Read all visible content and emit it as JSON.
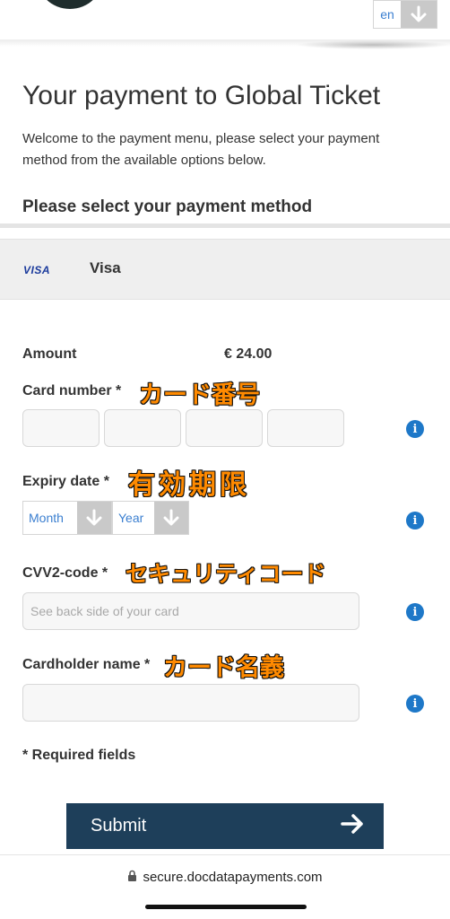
{
  "header": {
    "language": "en",
    "language_toggle_icon": "arrow-down-icon"
  },
  "page": {
    "title": "Your payment to Global Ticket",
    "intro": "Welcome to the payment menu, please select your payment method from the available options below.",
    "select_heading": "Please select your payment method"
  },
  "payment_method": {
    "logo_text": "VISA",
    "name": "Visa"
  },
  "form": {
    "amount_label": "Amount",
    "amount_value": "€ 24.00",
    "card_number_label": "Card number *",
    "card_number_annotation": "カード番号",
    "expiry_label": "Expiry date *",
    "expiry_annotation": "有効期限",
    "expiry_month": "Month",
    "expiry_year": "Year",
    "cvv_label": "CVV2-code *",
    "cvv_annotation": "セキュリティコード",
    "cvv_placeholder": "See back side of your card",
    "holder_label": "Cardholder name *",
    "holder_annotation": "カード名義",
    "required_note": "* Required fields",
    "info_icon": "info-icon"
  },
  "submit": {
    "label": "Submit",
    "icon": "arrow-right-icon"
  },
  "footer": {
    "url": "secure.docdatapayments.com",
    "lock_icon": "lock-icon"
  },
  "colors": {
    "submit_bg": "#1e3f5a",
    "info_icon": "#1e78c8",
    "select_text": "#3b7fd0",
    "annotation": "#ff8a00"
  }
}
